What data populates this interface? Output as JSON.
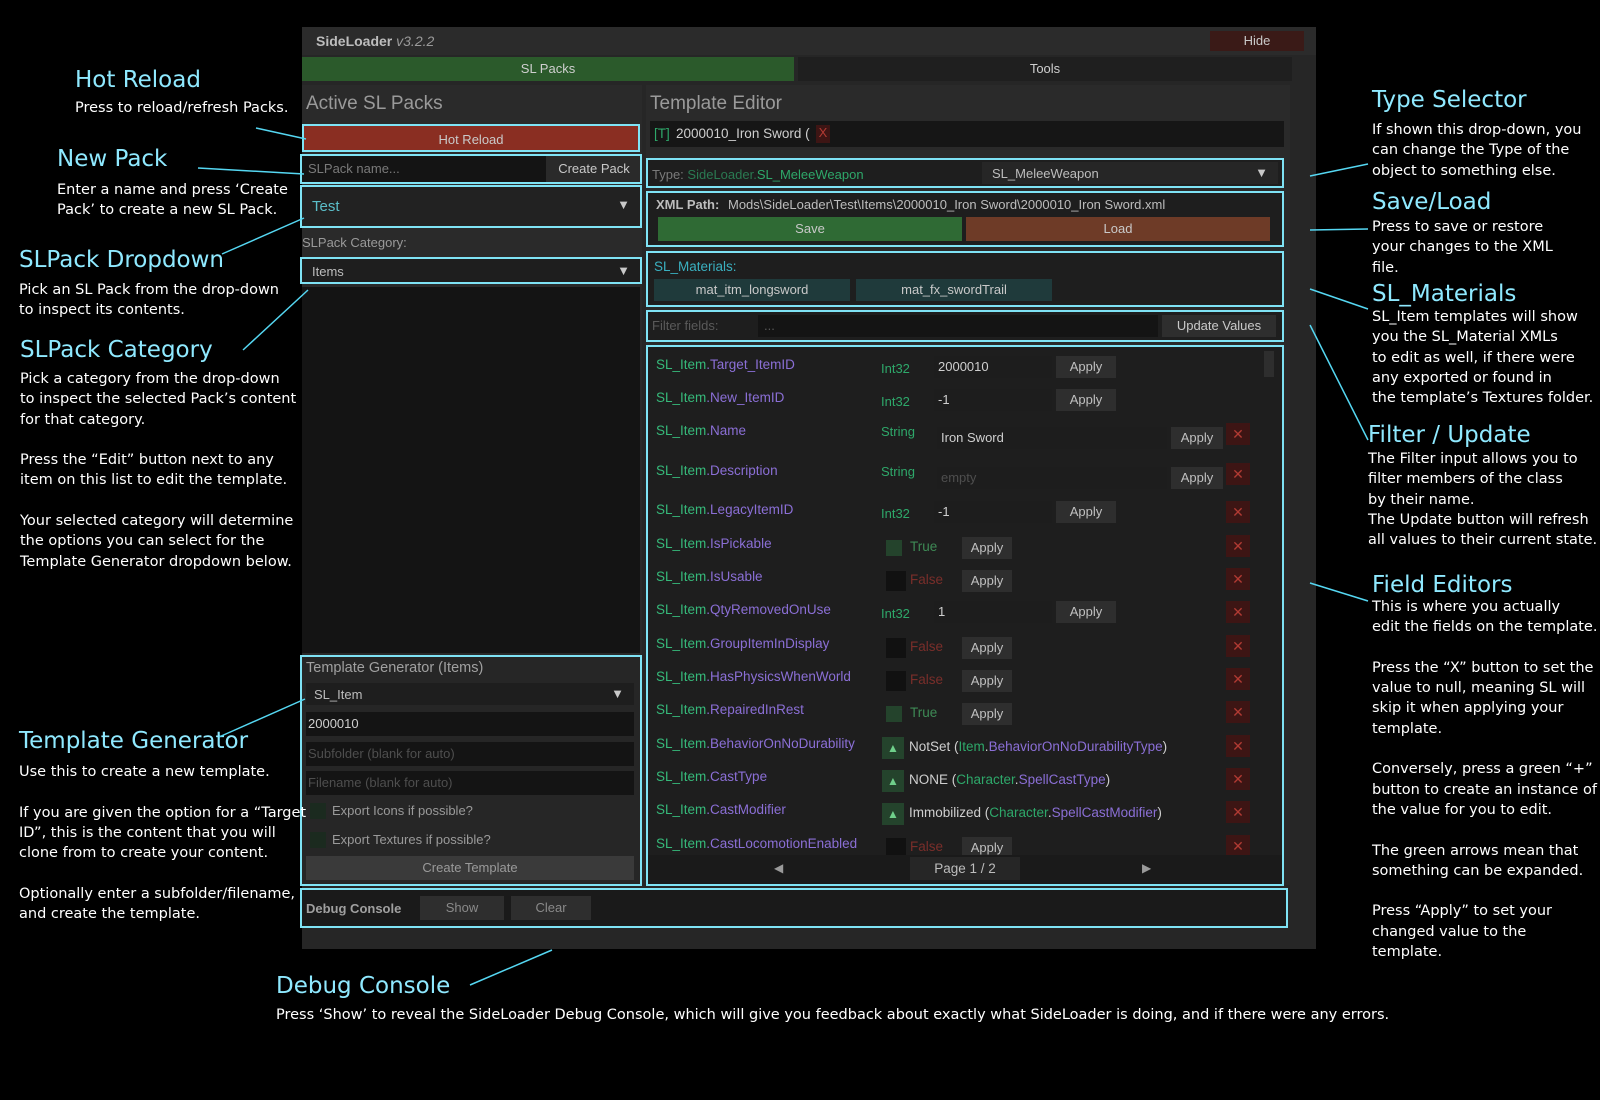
{
  "app": {
    "title": "SideLoader",
    "version": "v3.2.2",
    "hide_label": "Hide",
    "tabs": [
      {
        "label": "SL Packs",
        "active": true
      },
      {
        "label": "Tools",
        "active": false
      }
    ]
  },
  "left_panel": {
    "title": "Active SL Packs",
    "hot_reload_label": "Hot Reload",
    "pack_name_placeholder": "SLPack name...",
    "create_pack_label": "Create Pack",
    "selected_pack": "Test",
    "category_label": "SLPack Category:",
    "selected_category": "Items"
  },
  "template_generator": {
    "title": "Template Generator (Items)",
    "selected_type": "SL_Item",
    "target_id": "2000010",
    "subfolder_placeholder": "Subfolder (blank for auto)",
    "filename_placeholder": "Filename (blank for auto)",
    "export_icons_label": "Export Icons if possible?",
    "export_textures_label": "Export Textures if possible?",
    "create_label": "Create Template"
  },
  "debug_console": {
    "title": "Debug Console",
    "show_label": "Show",
    "clear_label": "Clear"
  },
  "template_editor": {
    "title": "Template Editor",
    "current_tag": "[T]",
    "current_name": "2000010_Iron Sword (",
    "current_close": "X",
    "type_prefix": "Type: ",
    "type_ns": "SideLoader.",
    "type_name": "SL_MeleeWeapon",
    "type_selected": "SL_MeleeWeapon",
    "xml_path_label": "XML Path:",
    "xml_path": "Mods\\SideLoader\\Test\\Items\\2000010_Iron Sword\\2000010_Iron Sword.xml",
    "save_label": "Save",
    "load_label": "Load",
    "materials_label": "SL_Materials:",
    "materials": [
      "mat_itm_longsword",
      "mat_fx_swordTrail"
    ],
    "filter_label": "Filter fields:",
    "filter_placeholder": "...",
    "update_values_label": "Update Values",
    "page_label": "Page 1 / 2",
    "prev_icon": "◀",
    "next_icon": "▶"
  },
  "fields": [
    {
      "cls": "SL_Item",
      "name": "Target_ItemID",
      "kind": "value",
      "type": "Int32",
      "value": "2000010",
      "apply": "Apply",
      "x": false
    },
    {
      "cls": "SL_Item",
      "name": "New_ItemID",
      "kind": "value",
      "type": "Int32",
      "value": "-1",
      "apply": "Apply",
      "x": false
    },
    {
      "cls": "SL_Item",
      "name": "Name",
      "kind": "value",
      "type": "String",
      "value": "Iron Sword",
      "apply": "Apply",
      "x": true,
      "wide": true
    },
    {
      "cls": "SL_Item",
      "name": "Description",
      "kind": "value",
      "type": "String",
      "value": "empty",
      "placeholder": true,
      "apply": "Apply",
      "x": true,
      "wide": true
    },
    {
      "cls": "SL_Item",
      "name": "LegacyItemID",
      "kind": "value",
      "type": "Int32",
      "value": "-1",
      "apply": "Apply",
      "x": true
    },
    {
      "cls": "SL_Item",
      "name": "IsPickable",
      "kind": "bool",
      "value": "True",
      "apply": "Apply",
      "x": true
    },
    {
      "cls": "SL_Item",
      "name": "IsUsable",
      "kind": "bool",
      "value": "False",
      "apply": "Apply",
      "x": true
    },
    {
      "cls": "SL_Item",
      "name": "QtyRemovedOnUse",
      "kind": "value",
      "type": "Int32",
      "value": "1",
      "apply": "Apply",
      "x": true
    },
    {
      "cls": "SL_Item",
      "name": "GroupItemInDisplay",
      "kind": "bool",
      "value": "False",
      "apply": "Apply",
      "x": true
    },
    {
      "cls": "SL_Item",
      "name": "HasPhysicsWhenWorld",
      "kind": "bool",
      "value": "False",
      "apply": "Apply",
      "x": true
    },
    {
      "cls": "SL_Item",
      "name": "RepairedInRest",
      "kind": "bool",
      "value": "True",
      "apply": "Apply",
      "x": true
    },
    {
      "cls": "SL_Item",
      "name": "BehaviorOnNoDurability",
      "kind": "enum",
      "value": "NotSet",
      "enum_cls": "Item",
      "enum_type": "BehaviorOnNoDurabilityType",
      "x": true
    },
    {
      "cls": "SL_Item",
      "name": "CastType",
      "kind": "enum",
      "value": "NONE",
      "enum_cls": "Character",
      "enum_type": "SpellCastType",
      "x": true
    },
    {
      "cls": "SL_Item",
      "name": "CastModifier",
      "kind": "enum",
      "value": "Immobilized",
      "enum_cls": "Character",
      "enum_type": "SpellCastModifier",
      "x": true
    },
    {
      "cls": "SL_Item",
      "name": "CastLocomotionEnabled",
      "kind": "bool",
      "value": "False",
      "apply": "Apply",
      "x": true
    }
  ],
  "annotations": [
    {
      "id": "hot-reload",
      "title": "Hot Reload",
      "text": "Press to reload/refresh Packs."
    },
    {
      "id": "new-pack",
      "title": "New Pack",
      "text": "Enter a name and press ‘Create\nPack’ to create a new SL Pack."
    },
    {
      "id": "slpack-dropdown",
      "title": "SLPack Dropdown",
      "text": "Pick an SL Pack from the drop-down\nto inspect its contents."
    },
    {
      "id": "slpack-category",
      "title": "SLPack Category",
      "text": "Pick a category from the drop-down\nto inspect the selected Pack’s content\nfor that category.\n\nPress the “Edit” button next to any\nitem on this list to edit the template.\n\nYour selected category will determine\nthe options you can select for the\nTemplate Generator dropdown below."
    },
    {
      "id": "template-generator",
      "title": "Template Generator",
      "text": "Use this to create a new template.\n\nIf you are given the option for a “Target\nID”, this is the content that you will\nclone from to create your content.\n\nOptionally enter a subfolder/filename,\nand create the template."
    },
    {
      "id": "debug-console",
      "title": "Debug Console",
      "text": "Press ‘Show’ to reveal the SideLoader Debug Console, which will give you feedback about exactly what SideLoader is doing, and if there were any errors."
    },
    {
      "id": "type-selector",
      "title": "Type Selector",
      "text": "If shown this drop-down, you\ncan change the Type of the\nobject to something else."
    },
    {
      "id": "save-load",
      "title": "Save/Load",
      "text": "Press to save or restore\nyour changes to the XML\nfile."
    },
    {
      "id": "sl-materials",
      "title": "SL_Materials",
      "text": "SL_Item templates will show\nyou the SL_Material XMLs\nto edit as well, if there were\nany exported or found in\nthe template’s Textures folder."
    },
    {
      "id": "filter-update",
      "title": "Filter / Update",
      "text": "The Filter input allows you to\nfilter members of the class\nby their name.\nThe Update button will refresh\nall values to their current state."
    },
    {
      "id": "field-editors",
      "title": "Field Editors",
      "text": "This is where you actually\nedit the fields on the template.\n\nPress the “X” button to set the\nvalue to null, meaning SL will\nskip it when applying your\ntemplate.\n\nConversely, press a green “+”\nbutton to create an instance of\nthe value for you to edit.\n\nThe green arrows mean that\nsomething can be expanded.\n\nPress “Apply” to set your\nchanged value to the\ntemplate."
    }
  ],
  "colors": {
    "highlight": "#7fe3f5",
    "annotation_title": "#8fe9ff",
    "tab_active": "#2b5a2b",
    "hot_reload": "#8a2e22",
    "save": "#2f6a34",
    "load": "#6e3b27"
  }
}
